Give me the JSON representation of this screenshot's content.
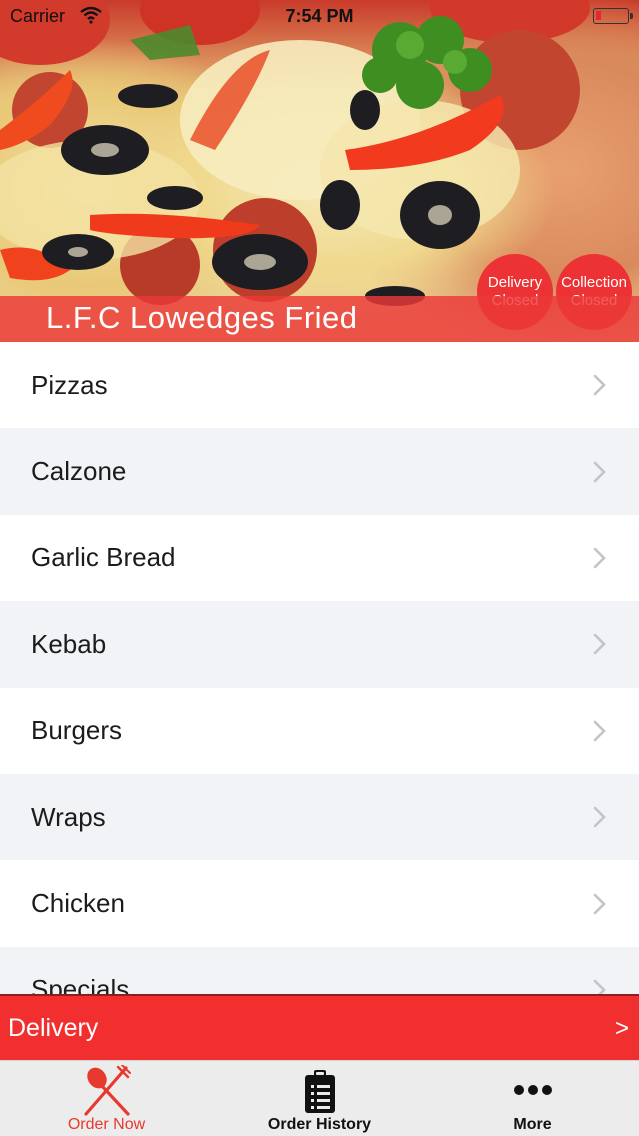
{
  "status_bar": {
    "carrier": "Carrier",
    "time": "7:54 PM",
    "icons": [
      "wifi-icon",
      "battery-icon"
    ]
  },
  "header": {
    "restaurant_name": "L.F.C Lowedges Fried",
    "delivery_badge": {
      "line1": "Delivery",
      "line2": "Closed"
    },
    "collection_badge": {
      "line1": "Collection",
      "line2": "Closed"
    }
  },
  "menu": {
    "categories": [
      {
        "label": "Pizzas"
      },
      {
        "label": "Calzone"
      },
      {
        "label": "Garlic Bread"
      },
      {
        "label": "Kebab"
      },
      {
        "label": "Burgers"
      },
      {
        "label": "Wraps"
      },
      {
        "label": "Chicken"
      },
      {
        "label": "Specials"
      }
    ],
    "row_icon": "chevron-right-icon"
  },
  "delivery_bar": {
    "label": "Delivery",
    "arrow": ">"
  },
  "tab_bar": {
    "tabs": [
      {
        "label": "Order Now",
        "icon": "fork-knife-icon",
        "active": true
      },
      {
        "label": "Order History",
        "icon": "clipboard-icon",
        "active": false
      },
      {
        "label": "More",
        "icon": "more-dots-icon",
        "active": false
      }
    ]
  },
  "colors": {
    "accent": "#f22f2f",
    "badge": "#ec3234",
    "row_alt": "#f1f3f7",
    "active_tab": "#e8392e"
  }
}
